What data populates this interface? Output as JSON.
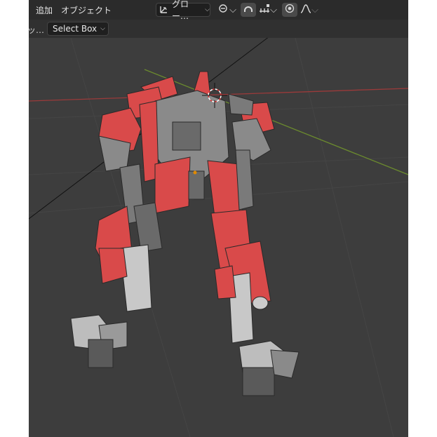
{
  "header": {
    "menu": {
      "add_label": "追加",
      "object_label": "オブジェクト"
    },
    "transform_orientation": {
      "icon": "transform-orientation-icon",
      "label": "グロー…"
    },
    "pivot_icon": "pivot-point-icon",
    "snap_icon": "snap-magnet-icon",
    "snap_target_icon": "snap-increment-icon",
    "proportional_icon": "proportional-edit-icon",
    "falloff_icon": "falloff-curve-icon"
  },
  "toolbar": {
    "truncated_label": "ッ…",
    "select_mode_value": "Select Box"
  },
  "viewport": {
    "background_color": "#3d3d3d",
    "grid_color": "#454545",
    "x_axis_color": "#9a3a3a",
    "y_axis_color": "#6b8a2e",
    "robot_red": "#d94a4a",
    "robot_gray": "#7a7a7a",
    "origin_color": "#e08a00"
  }
}
